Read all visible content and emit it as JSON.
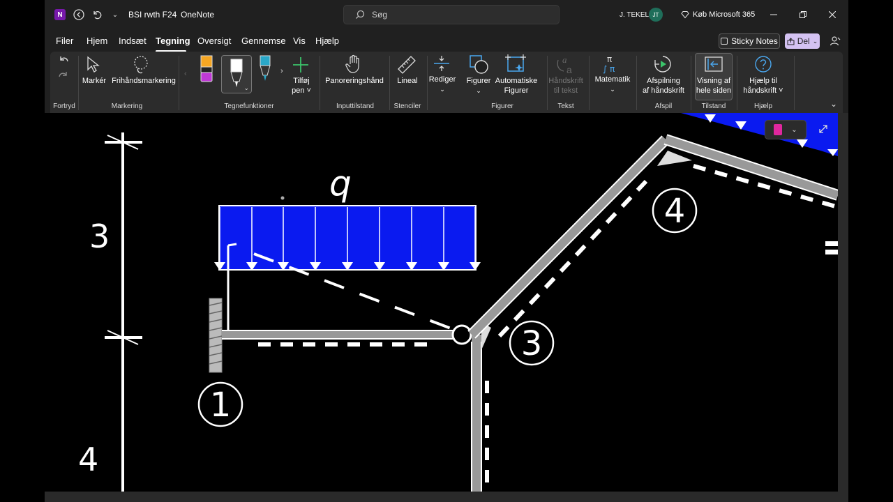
{
  "titlebar": {
    "app_logo": "N",
    "doc_title": "BSI rwth F24",
    "separator": "-",
    "app_name": "OneNote",
    "search_placeholder": "Søg",
    "user_name": "J. TEKEL",
    "user_initials": "JT",
    "buy_label": "Køb Microsoft 365"
  },
  "menu": {
    "items": [
      "Filer",
      "Hjem",
      "Indsæt",
      "Tegning",
      "Oversigt",
      "Gennemse",
      "Vis",
      "Hjælp"
    ],
    "active": "Tegning",
    "sticky_notes": "Sticky Notes",
    "share": "Del"
  },
  "ribbon": {
    "groups": {
      "undo": "Fortryd",
      "select": "Markering",
      "tools": "Tegnefunktioner",
      "input": "Inputtilstand",
      "stencils": "Stenciler",
      "shapes": "Figurer",
      "text": "Tekst",
      "math": "",
      "replay": "Afspil",
      "mode": "Tilstand",
      "help": "Hjælp"
    },
    "buttons": {
      "select": "Markér",
      "lasso": "Frihåndsmarkering",
      "add_pen_1": "Tilføj",
      "add_pen_2": "pen ˅",
      "pan": "Panoreringshånd",
      "ruler": "Lineal",
      "edit": "Rediger",
      "shapes": "Figurer",
      "auto_shapes_1": "Automatiske",
      "auto_shapes_2": "Figurer",
      "ink_text_1": "Håndskrift",
      "ink_text_2": "til tekst",
      "math": "Matematik",
      "replay_1": "Afspilning",
      "replay_2": "af håndskrift",
      "fullpage_1": "Visning af",
      "fullpage_2": "hele siden",
      "ink_help_1": "Hjælp til",
      "ink_help_2": "håndskrift ˅"
    }
  },
  "drawing": {
    "load_label": "q",
    "dim_upper": "3",
    "dim_lower": "4",
    "node_1": "1",
    "node_3": "3",
    "node_4": "4"
  },
  "colors": {
    "load_fill": "#0a1af0",
    "accent_purple": "#7719aa",
    "share_bg": "#d4c2f2",
    "notebook_pink": "#e0279e"
  }
}
